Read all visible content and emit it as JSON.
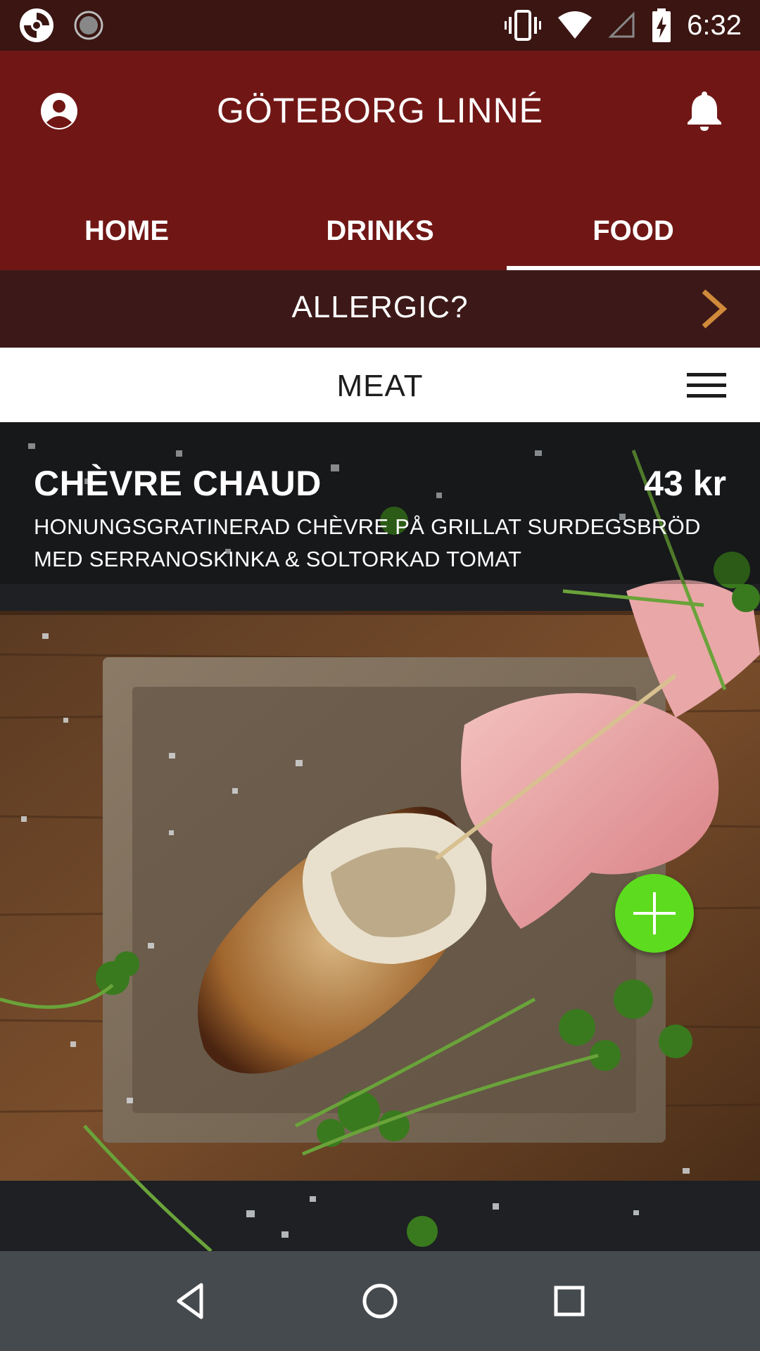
{
  "status_bar": {
    "time": "6:32",
    "icons": [
      "app-logo-icon",
      "sync-icon",
      "vibrate-icon",
      "wifi-icon",
      "cell-signal-icon",
      "battery-charging-icon"
    ]
  },
  "header": {
    "title": "GÖTEBORG LINNÉ",
    "account_icon": "account-circle-icon",
    "bell_icon": "bell-icon"
  },
  "tabs": [
    {
      "label": "HOME",
      "active": false
    },
    {
      "label": "DRINKS",
      "active": false
    },
    {
      "label": "FOOD",
      "active": true
    }
  ],
  "allergy": {
    "label": "ALLERGIC?",
    "icon": "chevron-right-icon",
    "accent": "#d08a3a"
  },
  "category": {
    "title": "MEAT",
    "icon": "hamburger-menu-icon"
  },
  "dish": {
    "name": "CHÈVRE CHAUD",
    "price": "43 kr",
    "description": "HONUNGSGRATINERAD CHÈVRE PÅ GRILLAT SURDEGSBRÖD MED SERRANOSKINKA & SOLTORKAD TOMAT",
    "add_icon": "plus-icon",
    "add_color": "#5ddb1f"
  },
  "nav_bar": {
    "icons": [
      "back-icon",
      "home-icon",
      "recents-icon"
    ]
  },
  "colors": {
    "header": "#701716",
    "status_bar": "#3a1512",
    "allergy_bar": "#3c1918",
    "nav_bar": "#454a4e"
  }
}
